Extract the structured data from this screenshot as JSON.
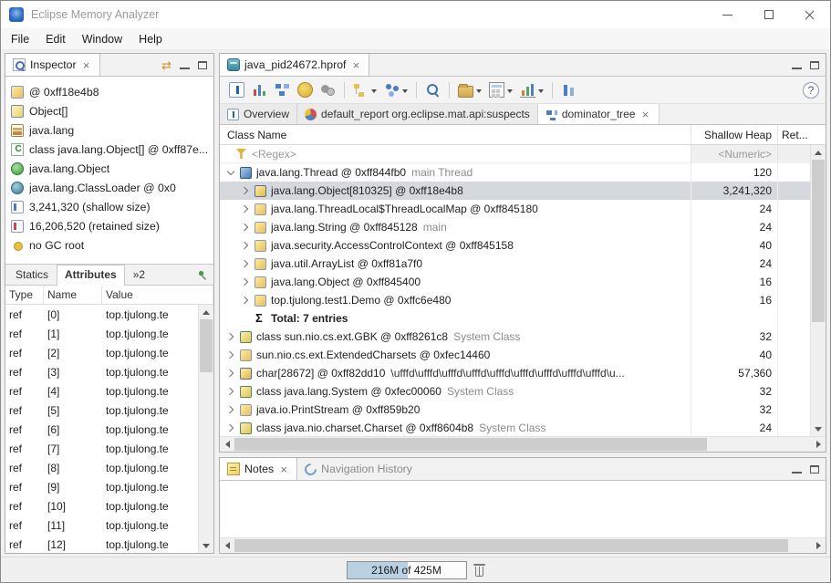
{
  "window": {
    "title": "Eclipse Memory Analyzer"
  },
  "menubar": {
    "items": [
      "File",
      "Edit",
      "Window",
      "Help"
    ]
  },
  "inspector": {
    "title": "Inspector",
    "items": [
      {
        "icon": "instance-icon",
        "label": "@ 0xff18e4b8"
      },
      {
        "icon": "array-class-icon",
        "label": "Object[]"
      },
      {
        "icon": "package-icon",
        "label": "java.lang"
      },
      {
        "icon": "class-file-icon",
        "label": "class java.lang.Object[] @ 0xff87e..."
      },
      {
        "icon": "object-class-icon",
        "label": "java.lang.Object"
      },
      {
        "icon": "classloader-icon",
        "label": "java.lang.ClassLoader @ 0x0"
      },
      {
        "icon": "shallow-size-icon",
        "label": "3,241,320 (shallow size)"
      },
      {
        "icon": "retained-size-icon",
        "label": "16,206,520 (retained size)"
      },
      {
        "icon": "gc-root-icon",
        "label": "no GC root"
      }
    ],
    "tabs": [
      {
        "name": "statics",
        "label": "Statics",
        "active": false
      },
      {
        "name": "attributes",
        "label": "Attributes",
        "active": true
      },
      {
        "name": "overflow",
        "label": "»2",
        "active": false
      }
    ],
    "table": {
      "columns": [
        "Type",
        "Name",
        "Value"
      ],
      "rows": [
        {
          "type": "ref",
          "name": "[0]",
          "value": "top.tjulong.te"
        },
        {
          "type": "ref",
          "name": "[1]",
          "value": "top.tjulong.te"
        },
        {
          "type": "ref",
          "name": "[2]",
          "value": "top.tjulong.te"
        },
        {
          "type": "ref",
          "name": "[3]",
          "value": "top.tjulong.te"
        },
        {
          "type": "ref",
          "name": "[4]",
          "value": "top.tjulong.te"
        },
        {
          "type": "ref",
          "name": "[5]",
          "value": "top.tjulong.te"
        },
        {
          "type": "ref",
          "name": "[6]",
          "value": "top.tjulong.te"
        },
        {
          "type": "ref",
          "name": "[7]",
          "value": "top.tjulong.te"
        },
        {
          "type": "ref",
          "name": "[8]",
          "value": "top.tjulong.te"
        },
        {
          "type": "ref",
          "name": "[9]",
          "value": "top.tjulong.te"
        },
        {
          "type": "ref",
          "name": "[10]",
          "value": "top.tjulong.te"
        },
        {
          "type": "ref",
          "name": "[11]",
          "value": "top.tjulong.te"
        },
        {
          "type": "ref",
          "name": "[12]",
          "value": "top.tjulong.te"
        }
      ]
    }
  },
  "editor": {
    "tab": {
      "label": "java_pid24672.hprof"
    },
    "help_label": "?",
    "toolbar": [
      {
        "name": "info-icon"
      },
      {
        "name": "histogram-icon"
      },
      {
        "name": "dominator-tree-icon"
      },
      {
        "name": "oql-icon"
      },
      {
        "name": "thread-overview-icon"
      },
      {
        "name": "separator"
      },
      {
        "name": "heap-objects-icon",
        "dropdown": true
      },
      {
        "name": "group-by-icon",
        "dropdown": true
      },
      {
        "name": "separator"
      },
      {
        "name": "search-icon"
      },
      {
        "name": "separator"
      },
      {
        "name": "export-icon",
        "dropdown": true
      },
      {
        "name": "calculator-icon",
        "dropdown": true
      },
      {
        "name": "chart-icon",
        "dropdown": true
      },
      {
        "name": "separator"
      },
      {
        "name": "compare-icon"
      }
    ],
    "subtabs": [
      {
        "name": "overview",
        "icon": "overview-icon",
        "label": "Overview",
        "active": false,
        "closable": false
      },
      {
        "name": "suspects-report",
        "icon": "report-icon",
        "label": "default_report org.eclipse.mat.api:suspects",
        "active": false,
        "closable": false
      },
      {
        "name": "dominator-tree",
        "icon": "dominator-icon",
        "label": "dominator_tree",
        "active": true,
        "closable": true
      }
    ],
    "tree": {
      "columns": {
        "name": "Class Name",
        "shallow": "Shallow Heap",
        "retained": "Ret..."
      },
      "filters": {
        "regex": "<Regex>",
        "numeric": "<Numeric>"
      },
      "rows": [
        {
          "level": 0,
          "expand": "down",
          "icon": "thread-instance-icon",
          "label": "java.lang.Thread @ 0xff844fb0",
          "suffix": "main Thread",
          "shallow": "120",
          "selected": false
        },
        {
          "level": 1,
          "expand": "right",
          "icon": "array-instance-icon",
          "label": "java.lang.Object[810325] @ 0xff18e4b8",
          "shallow": "3,241,320",
          "selected": true
        },
        {
          "level": 1,
          "expand": "right",
          "icon": "instance-icon",
          "label": "java.lang.ThreadLocal$ThreadLocalMap @ 0xff845180",
          "shallow": "24"
        },
        {
          "level": 1,
          "expand": "right",
          "icon": "instance-icon",
          "label": "java.lang.String @ 0xff845128",
          "suffix": "main",
          "shallow": "24"
        },
        {
          "level": 1,
          "expand": "right",
          "icon": "instance-icon",
          "label": "java.security.AccessControlContext @ 0xff845158",
          "shallow": "40"
        },
        {
          "level": 1,
          "expand": "right",
          "icon": "instance-icon",
          "label": "java.util.ArrayList @ 0xff81a7f0",
          "shallow": "24"
        },
        {
          "level": 1,
          "expand": "right",
          "icon": "instance-icon",
          "label": "java.lang.Object @ 0xff845400",
          "shallow": "16"
        },
        {
          "level": 1,
          "expand": "right",
          "icon": "instance-icon",
          "label": "top.tjulong.test1.Demo @ 0xffc6e480",
          "shallow": "16"
        },
        {
          "level": 1,
          "expand": "none",
          "icon": "sigma-icon",
          "label": "Total: 7 entries",
          "bold": true,
          "shallow": ""
        },
        {
          "level": 0,
          "expand": "right",
          "icon": "class-instance-icon",
          "label": "class sun.nio.cs.ext.GBK @ 0xff8261c8",
          "suffix": "System Class",
          "shallow": "32"
        },
        {
          "level": 0,
          "expand": "right",
          "icon": "instance-icon",
          "label": "sun.nio.cs.ext.ExtendedCharsets @ 0xfec14460",
          "shallow": "40"
        },
        {
          "level": 0,
          "expand": "right",
          "icon": "array-instance-icon",
          "label": "char[28672] @ 0xff82dd10",
          "value": "\\ufffd\\ufffd\\ufffd\\ufffd\\ufffd\\ufffd\\ufffd\\ufffd\\ufffd\\u...",
          "shallow": "57,360"
        },
        {
          "level": 0,
          "expand": "right",
          "icon": "class-instance-icon",
          "label": "class java.lang.System @ 0xfec00060",
          "suffix": "System Class",
          "shallow": "32"
        },
        {
          "level": 0,
          "expand": "right",
          "icon": "instance-icon",
          "label": "java.io.PrintStream @ 0xff859b20",
          "shallow": "32"
        },
        {
          "level": 0,
          "expand": "right",
          "icon": "class-instance-icon",
          "label": "class java.nio.charset.Charset @ 0xff8604b8",
          "suffix": "System Class",
          "shallow": "24"
        }
      ]
    }
  },
  "notes": {
    "tabs": [
      {
        "name": "notes",
        "icon": "notes-icon",
        "label": "Notes",
        "active": true,
        "closable": true
      },
      {
        "name": "navigation-history",
        "icon": "nav-history-icon",
        "label": "Navigation History",
        "active": false,
        "closable": false
      }
    ]
  },
  "statusbar": {
    "heap_label": "216M of 425M",
    "fill_percent": 51
  }
}
